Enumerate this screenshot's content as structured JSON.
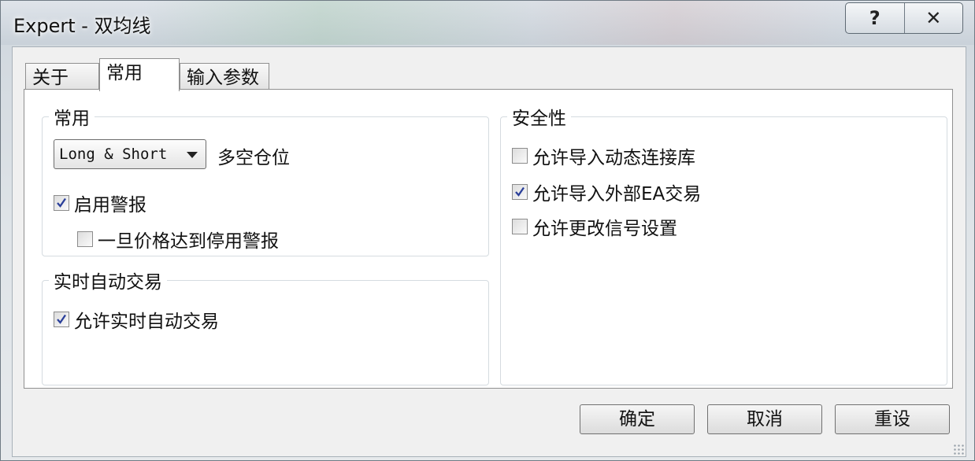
{
  "window": {
    "title": "Expert - 双均线",
    "help_label": "?",
    "close_label": "✕"
  },
  "tabs": [
    {
      "label": "关于",
      "active": false
    },
    {
      "label": "常用",
      "active": true
    },
    {
      "label": "输入参数",
      "active": false
    }
  ],
  "common_group": {
    "label": "常用",
    "position_select": {
      "value": "Long & Short"
    },
    "position_label": "多空仓位",
    "enable_alert": {
      "label": "启用警报",
      "checked": true
    },
    "disable_alert_on_price": {
      "label": "一旦价格达到停用警报",
      "checked": false
    }
  },
  "live_trading_group": {
    "label": "实时自动交易",
    "allow_live_trading": {
      "label": "允许实时自动交易",
      "checked": true
    }
  },
  "security_group": {
    "label": "安全性",
    "allow_dll_import": {
      "label": "允许导入动态连接库",
      "checked": false
    },
    "allow_external_ea": {
      "label": "允许导入外部EA交易",
      "checked": true
    },
    "allow_signal_change": {
      "label": "允许更改信号设置",
      "checked": false
    }
  },
  "buttons": {
    "ok": "确定",
    "cancel": "取消",
    "reset": "重设"
  }
}
